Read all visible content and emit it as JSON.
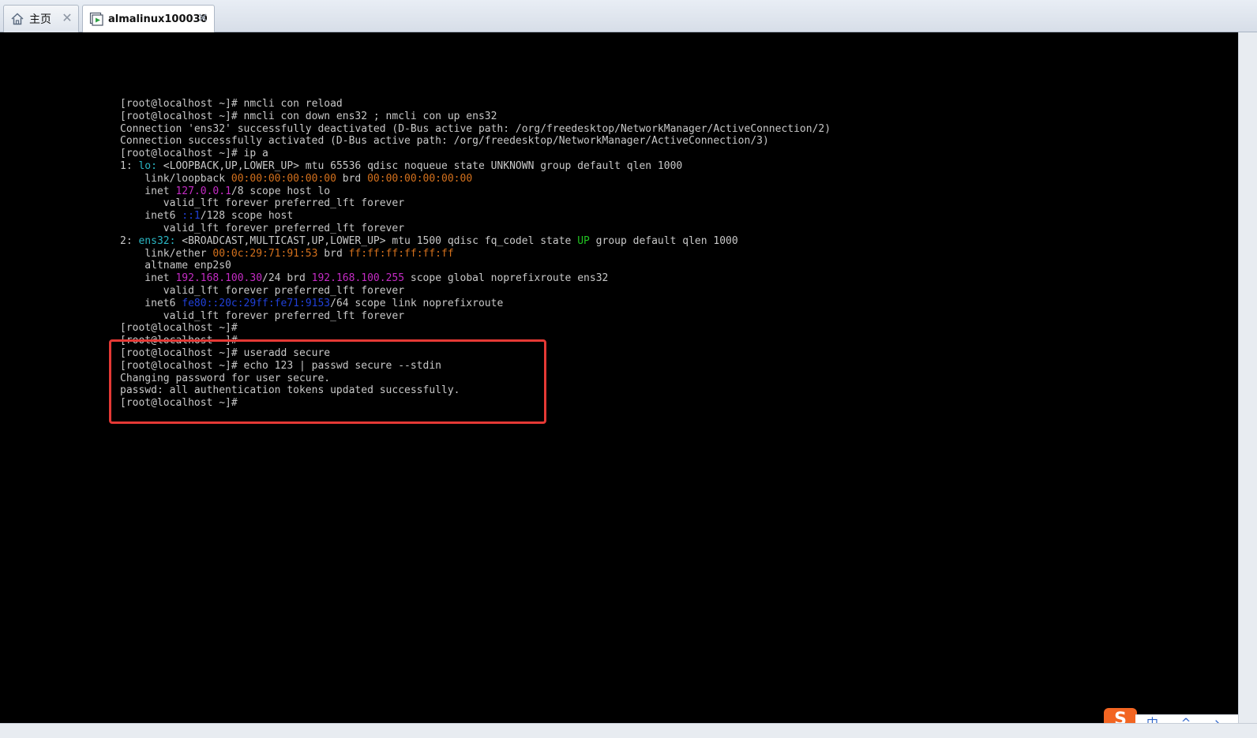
{
  "tabs": [
    {
      "label": "主页",
      "icon": "home-icon"
    },
    {
      "label": "almalinux100030",
      "icon": "vm-running-icon"
    }
  ],
  "terminal": {
    "lines": [
      [
        {
          "t": "[root@localhost ~]# nmcli con reload"
        }
      ],
      [
        {
          "t": "[root@localhost ~]# nmcli con down ens32 ; nmcli con up ens32"
        }
      ],
      [
        {
          "t": "Connection 'ens32' successfully deactivated (D-Bus active path: /org/freedesktop/NetworkManager/ActiveConnection/2)"
        }
      ],
      [
        {
          "t": "Connection successfully activated (D-Bus active path: /org/freedesktop/NetworkManager/ActiveConnection/3)"
        }
      ],
      [
        {
          "t": "[root@localhost ~]# ip a"
        }
      ],
      [
        {
          "t": "1: "
        },
        {
          "t": "lo:",
          "c": "cyan"
        },
        {
          "t": " <LOOPBACK,UP,LOWER_UP> mtu 65536 qdisc noqueue state UNKNOWN group default qlen 1000"
        }
      ],
      [
        {
          "t": "    link/loopback "
        },
        {
          "t": "00:00:00:00:00:00",
          "c": "orange"
        },
        {
          "t": " brd "
        },
        {
          "t": "00:00:00:00:00:00",
          "c": "orange"
        }
      ],
      [
        {
          "t": "    inet "
        },
        {
          "t": "127.0.0.1",
          "c": "magenta"
        },
        {
          "t": "/8 scope host lo"
        }
      ],
      [
        {
          "t": "       valid_lft forever preferred_lft forever"
        }
      ],
      [
        {
          "t": "    inet6 "
        },
        {
          "t": "::1",
          "c": "blue"
        },
        {
          "t": "/128 scope host"
        }
      ],
      [
        {
          "t": "       valid_lft forever preferred_lft forever"
        }
      ],
      [
        {
          "t": "2: "
        },
        {
          "t": "ens32:",
          "c": "cyan"
        },
        {
          "t": " <BROADCAST,MULTICAST,UP,LOWER_UP> mtu 1500 qdisc fq_codel state "
        },
        {
          "t": "UP",
          "c": "green"
        },
        {
          "t": " group default qlen 1000"
        }
      ],
      [
        {
          "t": "    link/ether "
        },
        {
          "t": "00:0c:29:71:91:53",
          "c": "orange"
        },
        {
          "t": " brd "
        },
        {
          "t": "ff:ff:ff:ff:ff:ff",
          "c": "orange"
        }
      ],
      [
        {
          "t": "    altname enp2s0"
        }
      ],
      [
        {
          "t": "    inet "
        },
        {
          "t": "192.168.100.30",
          "c": "magenta"
        },
        {
          "t": "/24 brd "
        },
        {
          "t": "192.168.100.255",
          "c": "magenta"
        },
        {
          "t": " scope global noprefixroute ens32"
        }
      ],
      [
        {
          "t": "       valid_lft forever preferred_lft forever"
        }
      ],
      [
        {
          "t": "    inet6 "
        },
        {
          "t": "fe80::20c:29ff:fe71:9153",
          "c": "blue"
        },
        {
          "t": "/64 scope link noprefixroute"
        }
      ],
      [
        {
          "t": "       valid_lft forever preferred_lft forever"
        }
      ],
      [
        {
          "t": "[root@localhost ~]#"
        }
      ],
      [
        {
          "t": "[root@localhost ~]#"
        }
      ],
      [
        {
          "t": "[root@localhost ~]# useradd secure"
        }
      ],
      [
        {
          "t": "[root@localhost ~]# echo 123 | passwd secure --stdin"
        }
      ],
      [
        {
          "t": "Changing password for user secure."
        }
      ],
      [
        {
          "t": "passwd: all authentication tokens updated successfully."
        }
      ],
      [
        {
          "t": "[root@localhost ~]#"
        }
      ]
    ]
  },
  "ime": {
    "logo": "S",
    "status": "中 ^ ↘ ✕"
  },
  "colors": {
    "cyan": "#2bb7c4",
    "orange": "#d4711d",
    "magenta": "#c42bc4",
    "blue": "#2040d8",
    "green": "#22c322",
    "highlight": "#e53935"
  }
}
